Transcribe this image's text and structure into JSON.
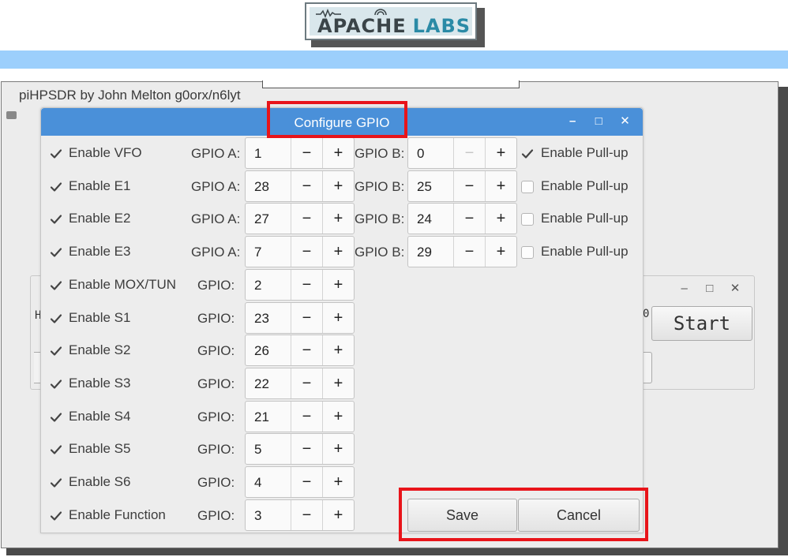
{
  "logo": {
    "word1": "APACHE",
    "word2": "LABS"
  },
  "main_window": {
    "title": "piHPSDR by John Melton g0orx/n6lyt"
  },
  "background_dialog": {
    "left_fragment": "H",
    "right_fragment": "0",
    "start_label": "Start",
    "controls": {
      "minimize": "–",
      "maximize": "□",
      "close": "✕"
    }
  },
  "dialog": {
    "title": "Configure GPIO",
    "controls": {
      "minimize": "–",
      "maximize": "□",
      "close": "✕"
    },
    "minus_symbol": "−",
    "plus_symbol": "+",
    "encoders": [
      {
        "label": "Enable VFO",
        "enabled": true,
        "gpio_a_label": "GPIO A:",
        "gpio_a": "1",
        "gpio_b_label": "GPIO B:",
        "gpio_b": "0",
        "gpio_b_min": true,
        "pullup_label": "Enable Pull-up",
        "pullup": true
      },
      {
        "label": "Enable E1",
        "enabled": true,
        "gpio_a_label": "GPIO A:",
        "gpio_a": "28",
        "gpio_b_label": "GPIO B:",
        "gpio_b": "25",
        "gpio_b_min": false,
        "pullup_label": "Enable Pull-up",
        "pullup": false
      },
      {
        "label": "Enable E2",
        "enabled": true,
        "gpio_a_label": "GPIO A:",
        "gpio_a": "27",
        "gpio_b_label": "GPIO B:",
        "gpio_b": "24",
        "gpio_b_min": false,
        "pullup_label": "Enable Pull-up",
        "pullup": false
      },
      {
        "label": "Enable E3",
        "enabled": true,
        "gpio_a_label": "GPIO A:",
        "gpio_a": "7",
        "gpio_b_label": "GPIO B:",
        "gpio_b": "29",
        "gpio_b_min": false,
        "pullup_label": "Enable Pull-up",
        "pullup": false
      }
    ],
    "switches": [
      {
        "label": "Enable MOX/TUN",
        "enabled": true,
        "gpio_label": "GPIO:",
        "gpio": "2"
      },
      {
        "label": "Enable S1",
        "enabled": true,
        "gpio_label": "GPIO:",
        "gpio": "23"
      },
      {
        "label": "Enable S2",
        "enabled": true,
        "gpio_label": "GPIO:",
        "gpio": "26"
      },
      {
        "label": "Enable S3",
        "enabled": true,
        "gpio_label": "GPIO:",
        "gpio": "22"
      },
      {
        "label": "Enable S4",
        "enabled": true,
        "gpio_label": "GPIO:",
        "gpio": "21"
      },
      {
        "label": "Enable S5",
        "enabled": true,
        "gpio_label": "GPIO:",
        "gpio": "5"
      },
      {
        "label": "Enable S6",
        "enabled": true,
        "gpio_label": "GPIO:",
        "gpio": "4"
      },
      {
        "label": "Enable Function",
        "enabled": true,
        "gpio_label": "GPIO:",
        "gpio": "3"
      }
    ],
    "save_label": "Save",
    "cancel_label": "Cancel"
  },
  "colors": {
    "titlebar": "#4a90d9",
    "band": "#9ccffc",
    "highlight": "#e8141a",
    "dialog_bg": "#ededed"
  }
}
